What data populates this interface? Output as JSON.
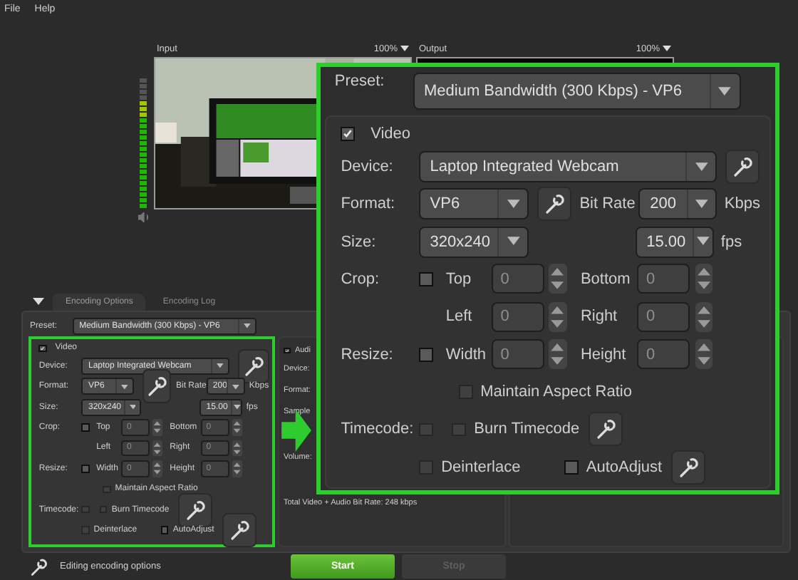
{
  "menu": [
    {
      "label": "File"
    },
    {
      "label": "Help"
    }
  ],
  "preview": {
    "input": {
      "label": "Input",
      "zoom": "100%",
      "level": 0.83
    },
    "output": {
      "label": "Output",
      "zoom": "100%"
    }
  },
  "tabs": [
    {
      "label": "Encoding Options",
      "selected": true
    },
    {
      "label": "Encoding Log",
      "selected": false
    }
  ],
  "encoding": {
    "preset": {
      "label": "Preset:",
      "value": "Medium Bandwidth (300 Kbps) - VP6"
    },
    "video": {
      "label": "Video",
      "checked": true,
      "device": {
        "label": "Device:",
        "value": "Laptop Integrated Webcam"
      },
      "format": {
        "label": "Format:",
        "value": "VP6"
      },
      "bitrate": {
        "label": "Bit Rate",
        "value": "200",
        "unit": "Kbps"
      },
      "size": {
        "label": "Size:",
        "value": "320x240"
      },
      "fps": {
        "value": "15.00",
        "unit": "fps"
      },
      "crop": {
        "label": "Crop:",
        "checked": false,
        "fields": [
          {
            "label": "Top",
            "value": "0",
            "disabled": true
          },
          {
            "label": "Bottom",
            "value": "0",
            "disabled": true
          },
          {
            "label": "Left",
            "value": "0",
            "disabled": true
          },
          {
            "label": "Right",
            "value": "0",
            "disabled": true
          }
        ]
      },
      "resize": {
        "label": "Resize:",
        "checked": false,
        "fields": [
          {
            "label": "Width",
            "value": "0",
            "disabled": true
          },
          {
            "label": "Height",
            "value": "0",
            "disabled": true
          }
        ]
      },
      "aspect": {
        "label": "Maintain Aspect Ratio",
        "checked": false,
        "disabled": true
      },
      "timecode": {
        "label": "Timecode:",
        "checked": false,
        "disabled": true
      },
      "burn": {
        "label": "Burn Timecode",
        "checked": false,
        "disabled": true
      },
      "deinterlace": {
        "label": "Deinterlace",
        "checked": false,
        "disabled": true
      },
      "autoadjust": {
        "label": "AutoAdjust",
        "checked": false,
        "disabled": false
      }
    },
    "audio": {
      "label": "Audi",
      "checked": true,
      "fields": [
        "Device:",
        "Format:",
        "Sample",
        "Volume:"
      ]
    },
    "total": "Total Video + Audio Bit Rate:  248 kbps"
  },
  "callout": {
    "preset": {
      "label": "Preset:",
      "value": "Medium Bandwidth (300 Kbps) - VP6"
    },
    "video": {
      "label": "Video",
      "checked": true,
      "device": {
        "label": "Device:",
        "value": "Laptop Integrated Webcam"
      },
      "format": {
        "label": "Format:",
        "value": "VP6"
      },
      "bitrate": {
        "label": "Bit Rate",
        "value": "200",
        "unit": "Kbps"
      },
      "size": {
        "label": "Size:",
        "value": "320x240"
      },
      "fps": {
        "value": "15.00",
        "unit": "fps"
      },
      "crop": {
        "label": "Crop:",
        "checked": false,
        "fields": [
          {
            "label": "Top",
            "value": "0",
            "disabled": true
          },
          {
            "label": "Bottom",
            "value": "0",
            "disabled": true
          },
          {
            "label": "Left",
            "value": "0",
            "disabled": true
          },
          {
            "label": "Right",
            "value": "0",
            "disabled": true
          }
        ]
      },
      "resize": {
        "label": "Resize:",
        "checked": false,
        "fields": [
          {
            "label": "Width",
            "value": "0",
            "disabled": true
          },
          {
            "label": "Height",
            "value": "0",
            "disabled": true
          }
        ]
      },
      "aspect": {
        "label": "Maintain Aspect Ratio",
        "checked": false,
        "disabled": true
      },
      "timecode": {
        "label": "Timecode:",
        "checked": false,
        "disabled": true
      },
      "burn": {
        "label": "Burn Timecode",
        "checked": false,
        "disabled": true
      },
      "deinterlace": {
        "label": "Deinterlace",
        "checked": false,
        "disabled": true
      },
      "autoadjust": {
        "label": "AutoAdjust",
        "checked": false,
        "disabled": false
      }
    }
  },
  "status": {
    "text": "Editing encoding options"
  },
  "buttons": [
    {
      "label": "Start",
      "disabled": false
    },
    {
      "label": "Stop",
      "disabled": true
    }
  ]
}
